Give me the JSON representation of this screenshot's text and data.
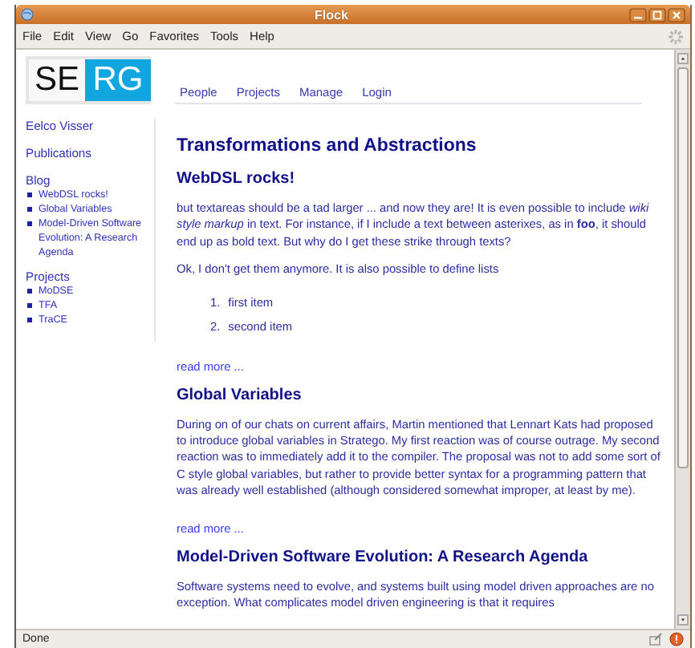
{
  "window": {
    "title": "Flock"
  },
  "menu": [
    "File",
    "Edit",
    "View",
    "Go",
    "Favorites",
    "Tools",
    "Help"
  ],
  "site": {
    "logo": {
      "dark": "SE",
      "light": "RG"
    },
    "nav": [
      "People",
      "Projects",
      "Manage",
      "Login"
    ]
  },
  "sidebar": {
    "links": [
      "Eelco Visser",
      "Publications"
    ],
    "sections": [
      {
        "title": "Blog",
        "items": [
          "WebDSL rocks!",
          "Global Variables",
          "Model-Driven Software Evolution: A Research Agenda"
        ]
      },
      {
        "title": "Projects",
        "items": [
          "MoDSE",
          "TFA",
          "TraCE"
        ]
      }
    ]
  },
  "main": {
    "title": "Transformations and Abstractions",
    "posts": [
      {
        "title": "WebDSL rocks!",
        "read_more": "read more ...",
        "blocks": [
          {
            "kind": "paragraph",
            "text": "but textareas should be a tad larger ... and now they are! It is even possible to include *wiki style markup* in text. For instance, if I include a text between asterixes, as in **foo**, it should end up as bold text. But why do I get these strike through texts?"
          },
          {
            "kind": "paragraph",
            "text": "Ok, I don't get them anymore. It is also possible to define lists"
          },
          {
            "kind": "list",
            "items": [
              {
                "number": "1.",
                "text": "first item"
              },
              {
                "number": "2.",
                "text": "second item"
              }
            ]
          }
        ]
      },
      {
        "title": "Global Variables",
        "read_more": "read more ...",
        "blocks": [
          {
            "kind": "paragraph",
            "text": "During on of our chats on current affairs, Martin mentioned that Lennart Kats had proposed to introduce global variables in Stratego. My first reaction was of course outrage. My second reaction was to immediately add it to the compiler. The proposal was not to add some sort of C style global variables, but rather to provide better syntax for a programming pattern that was already well established (although considered somewhat improper, at least by me)."
          }
        ]
      },
      {
        "title": "Model-Driven Software Evolution: A Research Agenda",
        "blocks": [
          {
            "kind": "paragraph",
            "text": "Software systems need to evolve, and systems built using model driven approaches are no exception. What complicates model driven engineering is that it requires"
          }
        ]
      }
    ]
  },
  "status_bar": {
    "text": "Done"
  }
}
